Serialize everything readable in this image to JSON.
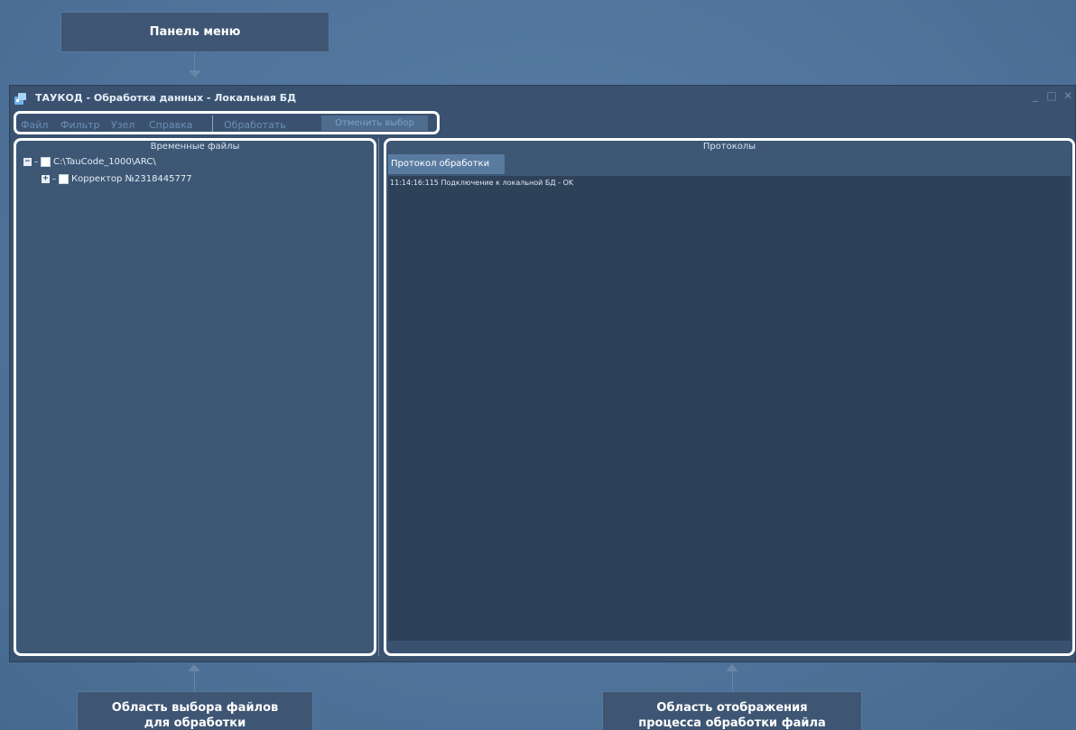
{
  "callouts": {
    "menu_panel": "Панель меню",
    "file_select_line1": "Область выбора файлов",
    "file_select_line2": "для обработки",
    "process_display_line1": "Область отображения",
    "process_display_line2": "процесса обработки файла"
  },
  "window": {
    "title": "ТАУКОД - Обработка данных - Локальная БД",
    "controls": {
      "minimize": "_",
      "maximize": "□",
      "close": "✕"
    }
  },
  "menu": {
    "items": [
      "Файл",
      "Фильтр",
      "Узел",
      "Справка"
    ],
    "process_label": "Обработать",
    "cancel_label": "Отменить выбор"
  },
  "left_panel": {
    "title": "Временные файлы",
    "tree": [
      {
        "toggle": "−",
        "label": "C:\\TauCode_1000\\ARC\\"
      },
      {
        "toggle": "+",
        "label": "Корректор №2318445777"
      }
    ]
  },
  "right_panel": {
    "title": "Протоколы",
    "tab_label": "Протокол обработки",
    "log_lines": [
      "11:14:16:115  Подключение к локальной БД - OK"
    ]
  },
  "colors": {
    "accent": "#ffffff",
    "window_bg": "#3a5270",
    "log_bg": "#2d4159",
    "menu_text": "#6b8fb6"
  },
  "icons": {
    "app": "app-icon",
    "check": "checkbox-icon"
  }
}
